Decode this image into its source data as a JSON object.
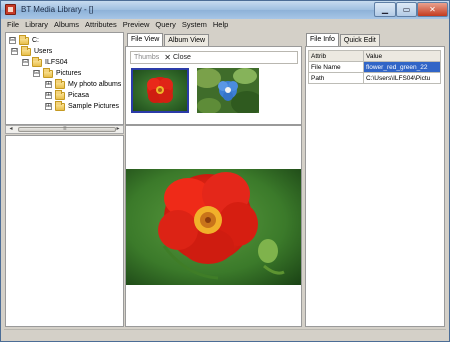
{
  "window": {
    "title": "BT Media Library - []",
    "close_glyph": "✕",
    "min_glyph": "▁",
    "max_glyph": "▭"
  },
  "menu": [
    "File",
    "Library",
    "Albums",
    "Attributes",
    "Preview",
    "Query",
    "System",
    "Help"
  ],
  "tree": [
    {
      "label": "C:",
      "expander": "⊟"
    },
    {
      "label": "Users",
      "expander": "⊟"
    },
    {
      "label": "ILFS04",
      "expander": "⊟"
    },
    {
      "label": "Pictures",
      "expander": "⊟"
    },
    {
      "label": "My photo albums",
      "expander": "⊞"
    },
    {
      "label": "Picasa",
      "expander": "⊞"
    },
    {
      "label": "Sample Pictures",
      "expander": "⊞"
    }
  ],
  "scroll": {
    "left_arrow": "◂",
    "right_arrow": "▸",
    "grip": "≡"
  },
  "center_tabs": [
    "File View",
    "Album View"
  ],
  "thumbbar": {
    "thumbs_label": "Thumbs",
    "close_label": "Close",
    "close_glyph": "✕"
  },
  "right_tabs": [
    "File Info",
    "Quick Edit"
  ],
  "info_table": {
    "headers": [
      "Attrib",
      "Value"
    ],
    "rows": [
      {
        "attrib": "File Name",
        "value": "flower_red_green_22"
      },
      {
        "attrib": "Path",
        "value": "C:\\Users\\ILFS04\\Pictu"
      }
    ]
  },
  "colors": {
    "title_bar": "#9fbfe0",
    "selection": "#3165c7",
    "thumb_selected_border": "#2b3ba8"
  }
}
